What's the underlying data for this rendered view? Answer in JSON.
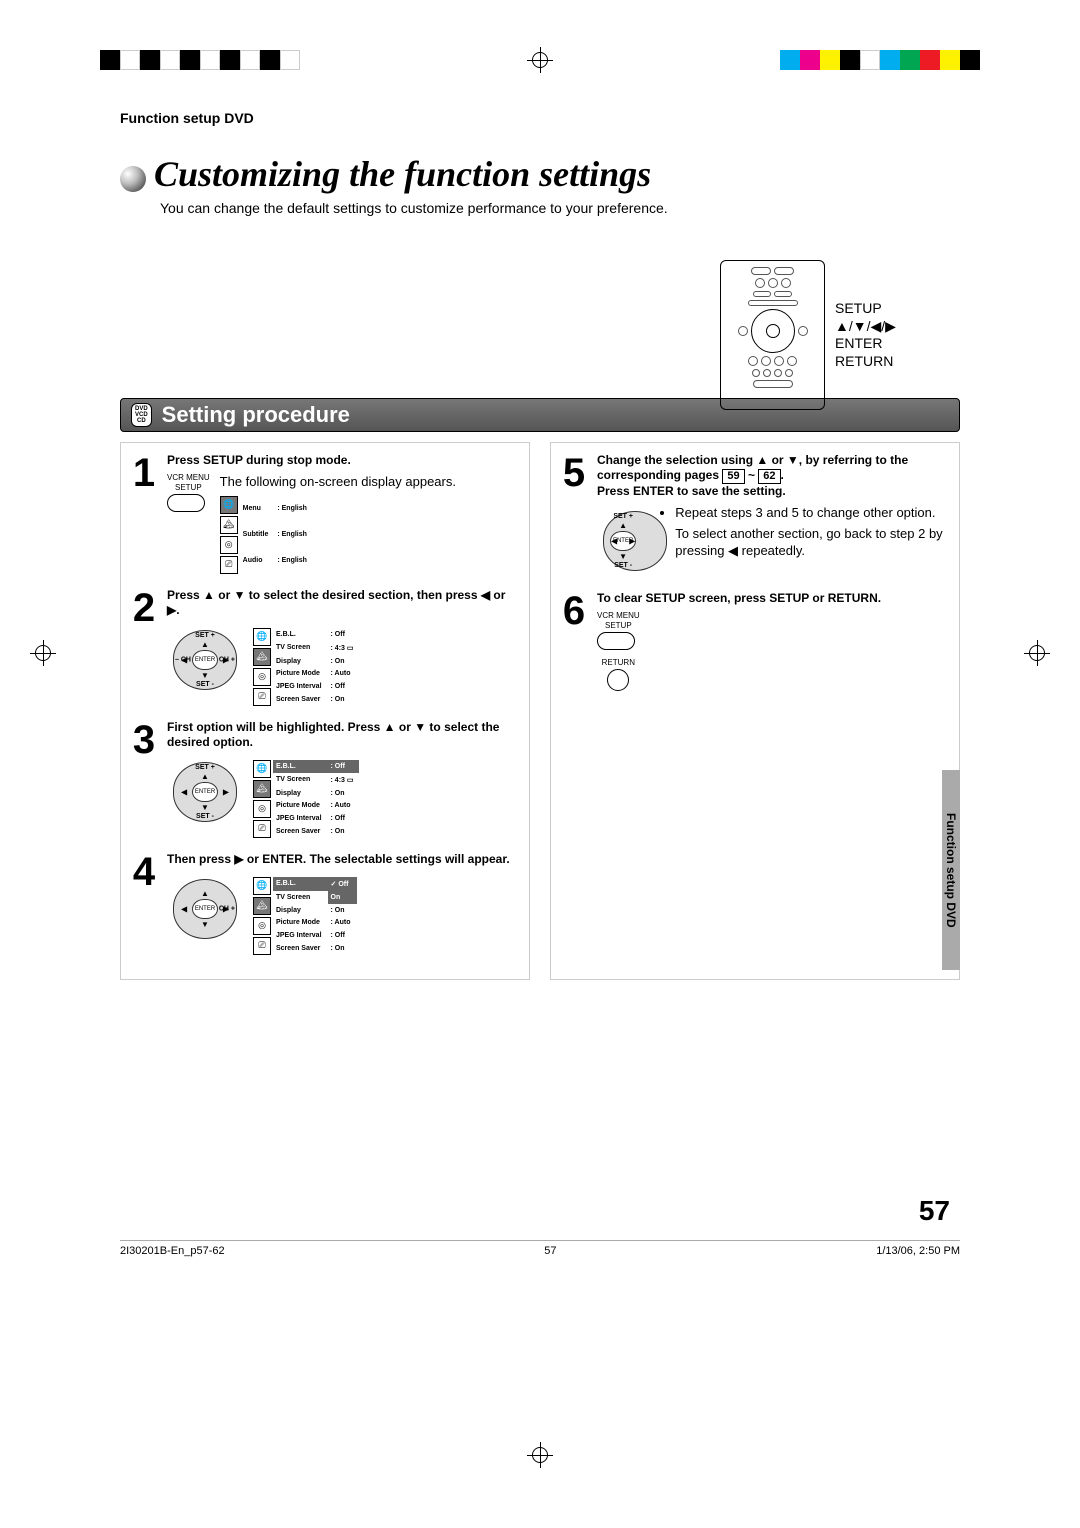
{
  "header": {
    "section_tag": "Function setup DVD"
  },
  "title": "Customizing the function settings",
  "intro": "You can change the default settings to customize performance to your preference.",
  "remote_labels": [
    "SETUP",
    "▲/▼/◀/▶",
    "ENTER",
    "RETURN"
  ],
  "banner": {
    "discs": [
      "DVD",
      "VCD",
      "CD"
    ],
    "title": "Setting procedure"
  },
  "btn_setup": {
    "top": "VCR MENU",
    "bottom": "SETUP"
  },
  "btn_return": {
    "top": "VCR MENU",
    "bottom": "SETUP",
    "under": "RETURN"
  },
  "steps_left": [
    {
      "n": "1",
      "lead": "Press SETUP during stop mode.",
      "body": "The following on-screen display appears.",
      "osd_active": 0,
      "osd_rows": [
        [
          "Menu",
          ": English"
        ],
        [
          "Subtitle",
          ": English"
        ],
        [
          "Audio",
          ": English"
        ]
      ]
    },
    {
      "n": "2",
      "lead": "Press ▲ or ▼ to select the desired section, then press ◀ or ▶.",
      "dpad": {
        "center": "ENTER",
        "up": "SET +",
        "dn": "SET -",
        "lf": "– CH",
        "rt": "CH +"
      },
      "osd_active": 1,
      "osd_rows": [
        [
          "E.B.L.",
          ": Off"
        ],
        [
          "TV Screen",
          ": 4:3 ▭"
        ],
        [
          "Display",
          ": On"
        ],
        [
          "Picture Mode",
          ": Auto"
        ],
        [
          "JPEG Interval",
          ": Off"
        ],
        [
          "Screen Saver",
          ": On"
        ]
      ]
    },
    {
      "n": "3",
      "lead": "First option will be highlighted. Press ▲ or ▼ to select the desired option.",
      "dpad": {
        "center": "ENTER",
        "up": "SET +",
        "dn": "SET -",
        "lf": "",
        "rt": ""
      },
      "osd_active": 1,
      "hl_row": 0,
      "osd_rows": [
        [
          "E.B.L.",
          ": Off"
        ],
        [
          "TV Screen",
          ": 4:3 ▭"
        ],
        [
          "Display",
          ": On"
        ],
        [
          "Picture Mode",
          ": Auto"
        ],
        [
          "JPEG Interval",
          ": Off"
        ],
        [
          "Screen Saver",
          ": On"
        ]
      ]
    },
    {
      "n": "4",
      "lead": "Then press ▶ or ENTER. The selectable settings will appear.",
      "dpad": {
        "center": "ENTER",
        "up": "",
        "dn": "",
        "lf": "",
        "rt": "CH +"
      },
      "osd_active": 1,
      "hl_row": 0,
      "hl_val_row": 1,
      "osd_rows": [
        [
          "E.B.L.",
          "Off"
        ],
        [
          "TV Screen",
          "On"
        ],
        [
          "Display",
          ": On"
        ],
        [
          "Picture Mode",
          ": Auto"
        ],
        [
          "JPEG Interval",
          ": Off"
        ],
        [
          "Screen Saver",
          ": On"
        ]
      ]
    }
  ],
  "steps_right": [
    {
      "n": "5",
      "lead_parts": [
        "Change the selection using ▲ or ▼, by referring to the corresponding pages ",
        "59",
        " ~ ",
        "62",
        "."
      ],
      "lead_tail": " Press ENTER to save the setting.",
      "bullets": [
        "Repeat steps 3 and 5 to change other option.",
        "To select another section, go back to step 2 by pressing ◀ repeatedly."
      ],
      "dpad": {
        "center": "ENTER",
        "up": "SET +",
        "dn": "SET -",
        "lf": "",
        "rt": ""
      }
    },
    {
      "n": "6",
      "lead": "To clear SETUP screen, press SETUP or RETURN."
    }
  ],
  "side_tab": "Function setup DVD",
  "page_number": "57",
  "footer": {
    "file": "2I30201B-En_p57-62",
    "page": "57",
    "date": "1/13/06, 2:50 PM"
  },
  "color_bar": [
    "#00aeef",
    "#ec008c",
    "#fff200",
    "#000000",
    "#ffffff",
    "#00aeef",
    "#00a651",
    "#ed1c24",
    "#fff200",
    "#000000"
  ]
}
